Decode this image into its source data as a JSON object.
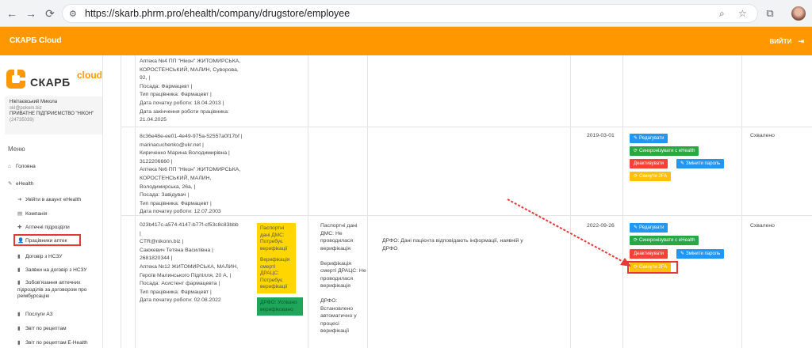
{
  "browser": {
    "url": "https://skarb.phrm.pro/ehealth/company/drugstore/employee",
    "back_icon": "←",
    "forward_icon": "→",
    "reload_icon": "⟳",
    "site_info_icon": "⚙",
    "zoom_icon": "⌕",
    "star_icon": "☆",
    "extensions_icon": "⧉",
    "more_icon": "⋮"
  },
  "appbar": {
    "title": "СКАРБ Cloud",
    "logout_label": "ВИЙТИ",
    "logout_icon": "⇥",
    "color": "#ff9800"
  },
  "sidebar": {
    "logo_text": "СКАРБ",
    "logo_cloud": "cloud",
    "user": {
      "name": "Нікітаєвський Микола",
      "email": "skl@pokem.biz",
      "company": "ПРИВАТНЕ ПІДПРИЄМСТВО \"НІКОН\"",
      "code": "(24735039)"
    },
    "menu_title": "Меню",
    "items": [
      {
        "label": "Головна",
        "icon": "⌂"
      },
      {
        "label": "eHealth",
        "icon": "✎"
      }
    ],
    "subitems": [
      {
        "label": "Увійти в акаунт eHealth",
        "icon": "➜"
      },
      {
        "label": "Компанія",
        "icon": "▤"
      },
      {
        "label": "Аптечні підрозділи",
        "icon": "✚"
      },
      {
        "label": "Працівники аптек",
        "icon": "👤"
      },
      {
        "label": "Договір з НСЗУ",
        "icon": "▮"
      },
      {
        "label": "Заявки на договір з НСЗУ",
        "icon": "▮"
      },
      {
        "label": "Зобов'язання аптечних підрозділів за договором про реімбурсацію",
        "icon": "▮"
      },
      {
        "label": "Послуги АЗ",
        "icon": "▮"
      },
      {
        "label": "Звіт по рецептам",
        "icon": "▮"
      },
      {
        "label": "Звіт по рецептам E-Health",
        "icon": "▮"
      }
    ]
  },
  "rows": [
    {
      "info": [
        "Аптека №4 ПП \"Нікон\" ЖИТОМИРСЬКА,",
        "КОРОСТЕНСЬКИЙ, МАЛИН, Суворова,",
        "92, |",
        "Посада: Фармацевт |",
        "Тип працівника: Фармацевт |",
        "Дата початку роботи: 18.04.2013 |",
        "Дата закінчення роботи працівника:",
        "21.04.2025"
      ]
    },
    {
      "info": [
        "8c36e48e-ee01-4e49-975a-52557a0f17bf |",
        "marinacuchenko@ukr.net |",
        "Кириченко Марина Володимирівна |",
        "3122206660 |",
        "Аптека №6 ПП \"Нікон\" ЖИТОМИРСЬКА,",
        "КОРОСТЕНСЬКИЙ, МАЛИН,",
        "Володимирська, 26а, |",
        "Посада: Завідувач |",
        "Тип працівника: Фармацевт |",
        "Дата початку роботи: 12.07.2003"
      ],
      "date": "2019-03-01",
      "status": "Схвалено",
      "buttons": {
        "edit": "Редагувати",
        "sync": "Синхронізувати с eHealth",
        "deactivate": "Деактивувати",
        "change_password": "Змінити пароль",
        "reset_2fa": "Скинути 2FA"
      }
    },
    {
      "info": [
        "023b417c-a574-4147-b77f-cf53c8c83bbb",
        "|",
        "CTR@nikonn.biz |",
        "Саюкевич Тетяна Василівна |",
        "2681820344 |",
        "Аптека №12 ЖИТОМИРСЬКА, МАЛИН,",
        "Героїв Малинського Підпілля, 20 А, |",
        "Посада: Асистент фармацевта |",
        "Тип працівника: Фармацевт |",
        "Дата початку роботи: 02.08.2022"
      ],
      "badges": [
        {
          "text": "Паспортні дані ДМС: Потребує верифікації",
          "color": "yellow"
        },
        {
          "text": "Верифікація смерті ДРАЦС: Потребує верифікації",
          "color": "yellow"
        },
        {
          "text": "ДРФО: Успішно верифіковано",
          "color": "green"
        }
      ],
      "details": [
        "Паспортні дані",
        "ДМС: Не",
        "проводилася",
        "верифікація",
        "",
        "Верифікація",
        "смерті ДРАЦС: Не",
        "проводилася",
        "верифікація",
        "",
        "ДРФО:",
        "Встановлено",
        "автоматично у",
        "процесі",
        "верифікації"
      ],
      "note": [
        "ДРФО: Дані пацієнта відповідають інформації, наявній у",
        "ДРФО"
      ],
      "date": "2022-09-26",
      "status": "Схвалено",
      "buttons": {
        "edit": "Редагувати",
        "sync": "Синхронізувати с eHealth",
        "deactivate": "Деактивувати",
        "change_password": "Змінити пароль",
        "reset_2fa": "Скинути 2FA"
      }
    }
  ],
  "icons": {
    "edit": "✎",
    "sync": "⟳",
    "key": "✎"
  }
}
